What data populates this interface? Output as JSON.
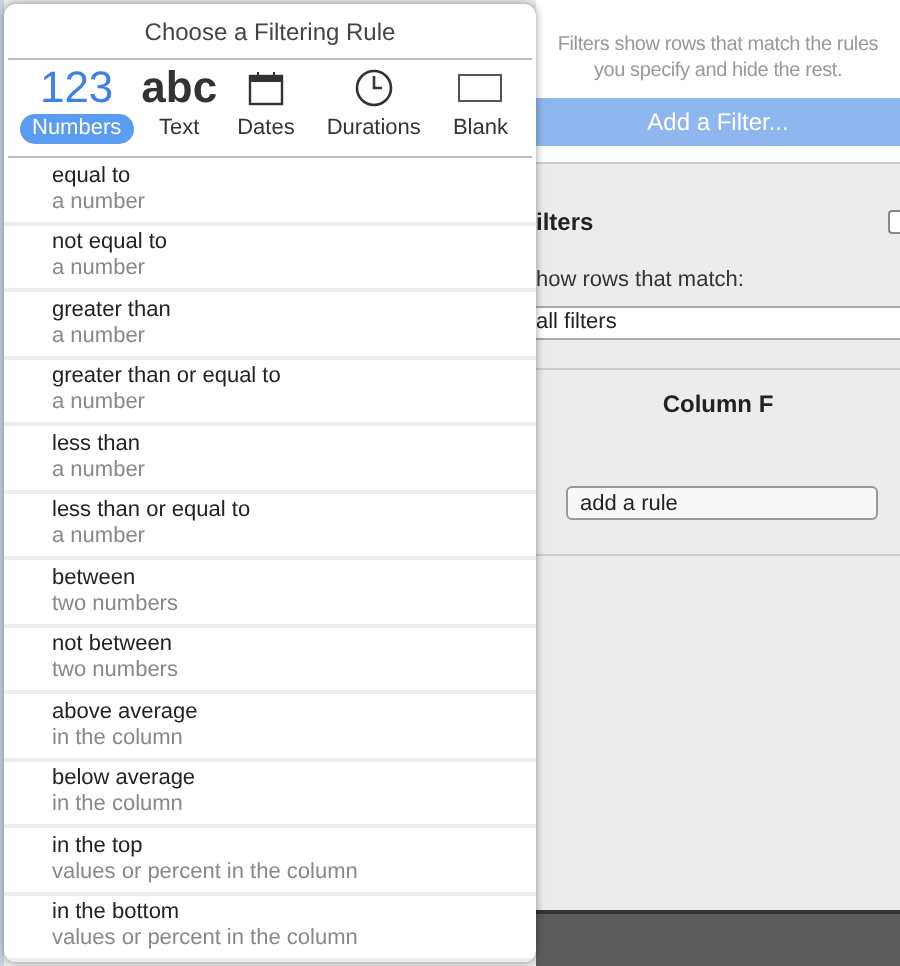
{
  "popover": {
    "title": "Choose a Filtering Rule",
    "tabs": [
      {
        "kind": "glyph",
        "glyph": "123",
        "label": "Numbers",
        "selected": true
      },
      {
        "kind": "glyph",
        "glyph": "abc",
        "label": "Text",
        "selected": false
      },
      {
        "kind": "calendar",
        "label": "Dates",
        "selected": false
      },
      {
        "kind": "clock",
        "label": "Durations",
        "selected": false
      },
      {
        "kind": "blank",
        "label": "Blank",
        "selected": false
      }
    ],
    "rules": [
      {
        "name": "equal to",
        "hint": "a number"
      },
      {
        "name": "not equal to",
        "hint": "a number"
      },
      {
        "name": "greater than",
        "hint": "a number"
      },
      {
        "name": "greater than or equal to",
        "hint": "a number"
      },
      {
        "name": "less than",
        "hint": "a number"
      },
      {
        "name": "less than or equal to",
        "hint": "a number"
      },
      {
        "name": "between",
        "hint": "two numbers"
      },
      {
        "name": "not between",
        "hint": "two numbers"
      },
      {
        "name": "above average",
        "hint": "in the column"
      },
      {
        "name": "below average",
        "hint": "in the column"
      },
      {
        "name": "in the top",
        "hint": "values or percent in the column"
      },
      {
        "name": "in the bottom",
        "hint": "values or percent in the column"
      }
    ]
  },
  "panel": {
    "intro": [
      "Filters show rows that match the rules",
      "you specify and hide the rest."
    ],
    "add_button": "Add a Filter...",
    "filters_label": "ilters",
    "filters_checked": false,
    "match_label": "how rows that match:",
    "match_value": "all filters",
    "column_title": "Column F",
    "rule_field": {
      "placeholder": "add a rule"
    }
  }
}
